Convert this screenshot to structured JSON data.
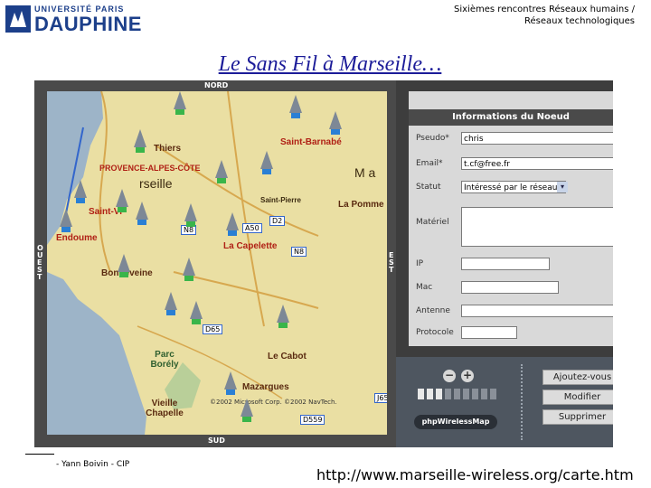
{
  "header": {
    "logo_top": "UNIVERSITÉ PARIS",
    "logo_main": "DAUPHINE",
    "event_line1": "Sixièmes rencontres Réseaux humains /",
    "event_line2": "Réseaux technologiques"
  },
  "slide": {
    "title": "Le Sans Fil à Marseille…"
  },
  "map": {
    "compass": {
      "north": "NORD",
      "south": "SUD",
      "east": "EST",
      "west": "OUEST"
    },
    "places": [
      {
        "text": "Thiers"
      },
      {
        "text": "Saint-Barnabé"
      },
      {
        "text": "PROVENCE-ALPES-CÔTE"
      },
      {
        "text": "rseille"
      },
      {
        "text": "Saint-Vi"
      },
      {
        "text": "Endoume"
      },
      {
        "text": "La Capelette"
      },
      {
        "text": "Le Cabot"
      },
      {
        "text": "Mazargues"
      },
      {
        "text": "Vieille Chapelle"
      },
      {
        "text": "Parc Borély"
      },
      {
        "text": "La Pomme"
      },
      {
        "text": "Bonneveine"
      },
      {
        "text": "Saint-Pierre"
      }
    ],
    "roads": [
      "A50",
      "D2",
      "N8",
      "N8",
      "D65",
      "J65",
      "D559"
    ],
    "copyright": "©2002 Microsoft Corp. ©2002 NavTech.",
    "overlay_text": "M a"
  },
  "panel": {
    "title": "Informations du Noeud",
    "fields": {
      "pseudo_label": "Pseudo*",
      "pseudo_value": "chris",
      "email_label": "Email*",
      "email_value": "t.cf@free.fr",
      "statut_label": "Statut",
      "statut_value": "Intéressé par le réseau",
      "materiel_label": "Matériel",
      "ip_label": "IP",
      "mac_label": "Mac",
      "antenne_label": "Antenne",
      "protocole_label": "Protocole"
    },
    "buttons": {
      "add": "Ajoutez-vous",
      "modify": "Modifier",
      "delete": "Supprimer"
    },
    "logo_text": "phpWirelessMap",
    "zoom_out": "−",
    "zoom_in": "+"
  },
  "footer": {
    "author": "- Yann Boivin - CIP",
    "url": "http://www.marseille-wireless.org/carte.htm"
  }
}
